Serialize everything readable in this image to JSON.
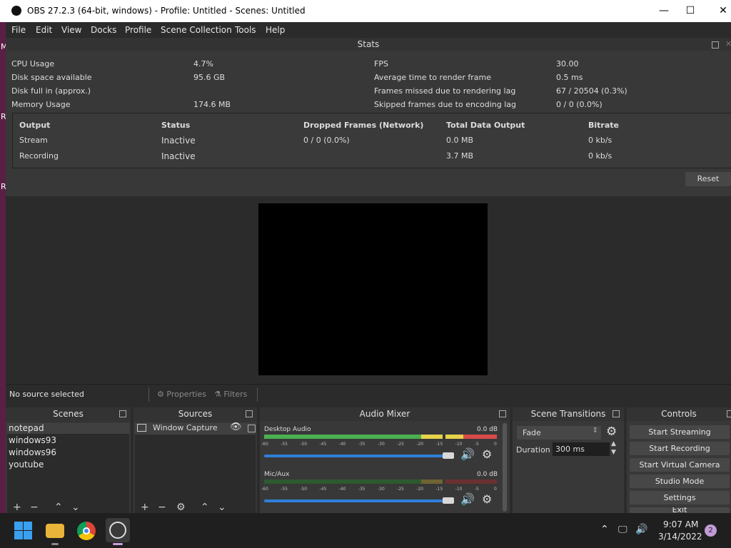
{
  "window": {
    "title": "OBS 27.2.3 (64-bit, windows) - Profile: Untitled - Scenes: Untitled",
    "minimize": "—",
    "maximize": "☐",
    "close": "✕"
  },
  "menu": [
    "File",
    "Edit",
    "View",
    "Docks",
    "Profile",
    "Scene Collection",
    "Tools",
    "Help"
  ],
  "desktop_edge_letters": [
    "M",
    "R",
    "R"
  ],
  "stats": {
    "title": "Stats",
    "left": [
      {
        "label": "CPU Usage",
        "value": "4.7%"
      },
      {
        "label": "Disk space available",
        "value": "95.6 GB"
      },
      {
        "label": "Disk full in (approx.)",
        "value": ""
      },
      {
        "label": "Memory Usage",
        "value": "174.6 MB"
      }
    ],
    "right": [
      {
        "label": "FPS",
        "value": "30.00"
      },
      {
        "label": "Average time to render frame",
        "value": "0.5 ms"
      },
      {
        "label": "Frames missed due to rendering lag",
        "value": "67 / 20504 (0.3%)"
      },
      {
        "label": "Skipped frames due to encoding lag",
        "value": "0 / 0 (0.0%)"
      }
    ],
    "outputs": {
      "headers": [
        "Output",
        "Status",
        "Dropped Frames (Network)",
        "Total Data Output",
        "Bitrate"
      ],
      "rows": [
        [
          "Stream",
          "Inactive",
          "0 / 0 (0.0%)",
          "0.0 MB",
          "0 kb/s"
        ],
        [
          "Recording",
          "Inactive",
          "",
          "3.7 MB",
          "0 kb/s"
        ]
      ]
    },
    "reset_label": "Reset"
  },
  "source_bar": {
    "status": "No source selected",
    "properties": "Properties",
    "filters": "Filters"
  },
  "scenes": {
    "title": "Scenes",
    "items": [
      "notepad",
      "windows93",
      "windows96",
      "youtube"
    ],
    "selected": "notepad"
  },
  "sources": {
    "title": "Sources",
    "items": [
      {
        "label": "Window Capture"
      }
    ]
  },
  "audio_mixer": {
    "title": "Audio Mixer",
    "channels": [
      {
        "name": "Desktop Audio",
        "db": "0.0 dB",
        "volume_percent": 100
      },
      {
        "name": "Mic/Aux",
        "db": "0.0 dB",
        "volume_percent": 100
      }
    ],
    "scale": [
      "-60",
      "-55",
      "-50",
      "-45",
      "-40",
      "-35",
      "-30",
      "-25",
      "-20",
      "-15",
      "-10",
      "-5",
      "0"
    ]
  },
  "scene_transitions": {
    "title": "Scene Transitions",
    "transition": "Fade",
    "duration_label": "Duration",
    "duration_value": "300 ms"
  },
  "controls": {
    "title": "Controls",
    "buttons": [
      "Start Streaming",
      "Start Recording",
      "Start Virtual Camera",
      "Studio Mode",
      "Settings",
      "Exit"
    ]
  },
  "taskbar": {
    "time": "9:07 AM",
    "date": "3/14/2022",
    "notification_count": "2",
    "apps": [
      "windows-start-icon",
      "file-explorer-icon",
      "chrome-icon",
      "obs-icon"
    ]
  },
  "colors": {
    "background": "#2b2b2b",
    "panel": "#383838",
    "meter_green": "#4caf50",
    "meter_yellow": "#e5d34a",
    "meter_red": "#d84a4a",
    "slider_blue": "#2f7fd8",
    "desktop_purple": "#5a1f45"
  }
}
